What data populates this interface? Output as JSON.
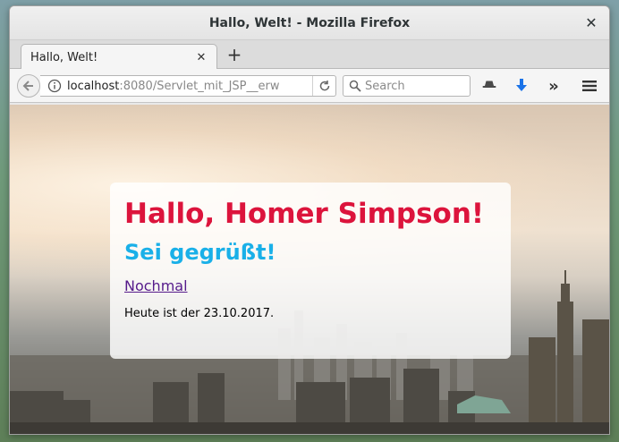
{
  "window": {
    "title": "Hallo, Welt! - Mozilla Firefox",
    "close_glyph": "✕"
  },
  "tabs": [
    {
      "label": "Hallo, Welt!",
      "close_glyph": "✕",
      "active": true
    }
  ],
  "newtab_glyph": "+",
  "navbar": {
    "url_host": "localhost",
    "url_rest": ":8080/Servlet_mit_JSP__erw",
    "search_placeholder": "Search",
    "icons": [
      "back-arrow-icon",
      "info-icon",
      "reload-icon",
      "search-icon",
      "incognito-icon",
      "download-icon",
      "overflow-chevron-icon",
      "hamburger-menu-icon"
    ],
    "overflow_glyph": "»"
  },
  "page": {
    "heading": "Hallo, Homer Simpson!",
    "subheading": "Sei gegrüßt!",
    "link_label": "Nochmal",
    "date_text": "Heute ist der 23.10.2017."
  },
  "colors": {
    "heading": "#dc143c",
    "subheading": "#1ab0e8",
    "link": "#551a8b",
    "download_icon": "#1a73e8"
  }
}
